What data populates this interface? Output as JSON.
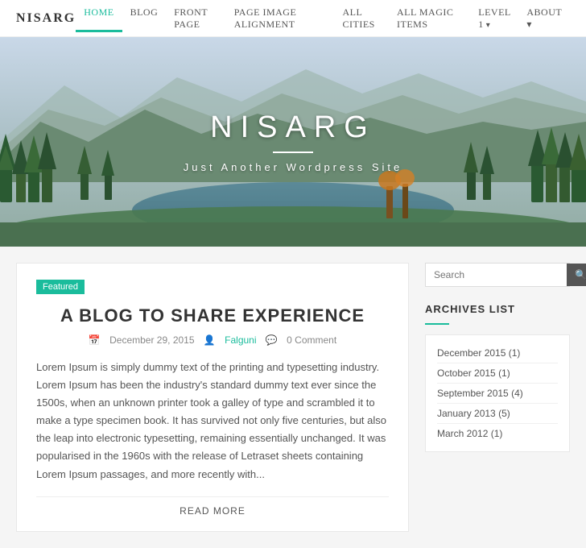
{
  "header": {
    "logo": "NISARG",
    "nav": [
      {
        "label": "HOME",
        "active": true,
        "has_dropdown": false
      },
      {
        "label": "BLOG",
        "active": false,
        "has_dropdown": false
      },
      {
        "label": "FRONT PAGE",
        "active": false,
        "has_dropdown": false
      },
      {
        "label": "PAGE IMAGE ALIGNMENT",
        "active": false,
        "has_dropdown": false
      },
      {
        "label": "ALL CITIES",
        "active": false,
        "has_dropdown": false
      },
      {
        "label": "ALL MAGIC ITEMS",
        "active": false,
        "has_dropdown": false
      },
      {
        "label": "LEVEL 1",
        "active": false,
        "has_dropdown": true
      },
      {
        "label": "ABOUT",
        "active": false,
        "has_dropdown": true
      }
    ]
  },
  "hero": {
    "title": "NISARG",
    "subtitle": "Just Another Wordpress Site"
  },
  "post": {
    "featured_label": "Featured",
    "title": "A BLOG TO SHARE EXPERIENCE",
    "date": "December 29, 2015",
    "author": "Falguni",
    "comments": "0 Comment",
    "excerpt": "Lorem Ipsum is simply dummy text of the printing and typesetting industry. Lorem Ipsum has been the industry's standard dummy text ever since the 1500s, when an unknown printer took a galley of type and scrambled it to make a type specimen book. It has survived not only five centuries, but also the leap into electronic typesetting, remaining essentially unchanged. It was popularised in the 1960s with the release of Letraset sheets containing Lorem Ipsum passages, and more recently with...",
    "read_more": "READ MORE"
  },
  "sidebar": {
    "search_placeholder": "Search",
    "archives_title": "ARCHIVES LIST",
    "archives": [
      {
        "label": "December 2015",
        "count": "(1)"
      },
      {
        "label": "October 2015",
        "count": "(1)"
      },
      {
        "label": "September 2015",
        "count": "(4)"
      },
      {
        "label": "January 2013",
        "count": "(5)"
      },
      {
        "label": "March 2012",
        "count": "(1)"
      }
    ]
  },
  "colors": {
    "accent": "#1abc9c"
  }
}
